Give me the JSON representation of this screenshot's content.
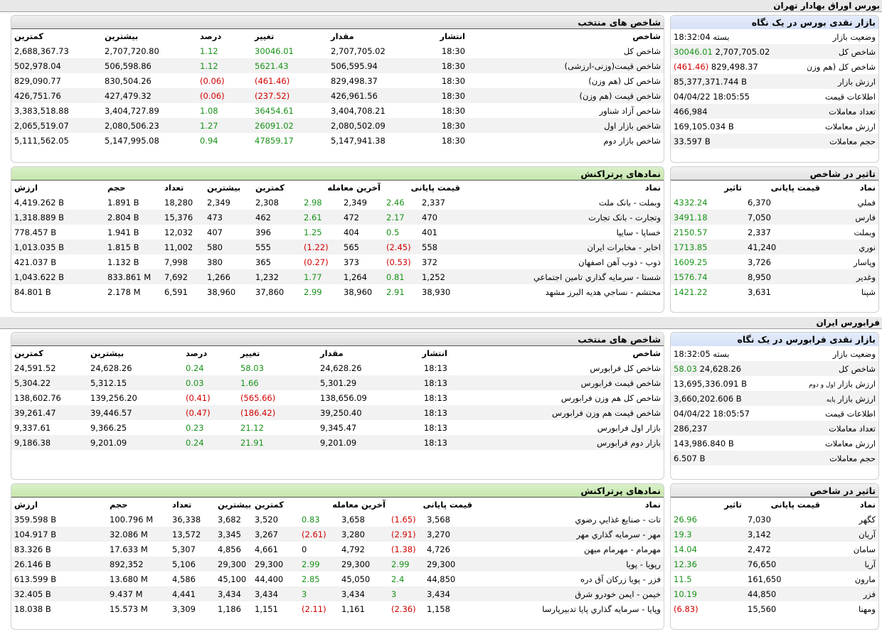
{
  "tse": {
    "title": "بورس اوراق بهادار تهران",
    "snapshot": {
      "title": "بازار نقدی بورس در یک نگاه",
      "rows": [
        {
          "label": "وضعیت بازار",
          "value": "بسته 18:32:04"
        },
        {
          "label": "شاخص کل",
          "value": "2,707,705.02",
          "change": "30046.01",
          "dir": "up"
        },
        {
          "label": "شاخص کل (هم وزن)",
          "value": "829,498.37",
          "change": "(461.46)",
          "dir": "down"
        },
        {
          "label": "ارزش بازار",
          "value": "85,377,371.744 B"
        },
        {
          "label": "اطلاعات قیمت",
          "value": "04/04/22 18:05:55"
        },
        {
          "label": "تعداد معاملات",
          "value": "466,984"
        },
        {
          "label": "ارزش معاملات",
          "value": "169,105.034 B"
        },
        {
          "label": "حجم معاملات",
          "value": "33.597 B"
        }
      ]
    },
    "indices": {
      "title": "شاخص های منتخب",
      "headers": {
        "name": "شاخص",
        "time": "انتشار",
        "value": "مقدار",
        "change": "تغییر",
        "percent": "درصد",
        "high": "بیشترین",
        "low": "کمترین"
      },
      "rows": [
        {
          "name": "شاخص کل",
          "time": "18:30",
          "value": "2,707,705.02",
          "change": "30046.01",
          "percent": "1.12",
          "high": "2,707,720.80",
          "low": "2,688,367.73",
          "dir": "up"
        },
        {
          "name": "شاخص قیمت(وزنی-ارزشی)",
          "time": "18:30",
          "value": "506,595.94",
          "change": "5621.43",
          "percent": "1.12",
          "high": "506,598.86",
          "low": "502,978.04",
          "dir": "up"
        },
        {
          "name": "شاخص کل (هم وزن)",
          "time": "18:30",
          "value": "829,498.37",
          "change": "(461.46)",
          "percent": "(0.06)",
          "high": "830,504.26",
          "low": "829,090.77",
          "dir": "down"
        },
        {
          "name": "شاخص قیمت (هم وزن)",
          "time": "18:30",
          "value": "426,961.56",
          "change": "(237.52)",
          "percent": "(0.06)",
          "high": "427,479.32",
          "low": "426,751.76",
          "dir": "down"
        },
        {
          "name": "شاخص آزاد شناور",
          "time": "18:30",
          "value": "3,404,708.21",
          "change": "36454.61",
          "percent": "1.08",
          "high": "3,404,727.89",
          "low": "3,383,518.88",
          "dir": "up"
        },
        {
          "name": "شاخص بازار اول",
          "time": "18:30",
          "value": "2,080,502.09",
          "change": "26091.02",
          "percent": "1.27",
          "high": "2,080,506.23",
          "low": "2,065,519.07",
          "dir": "up"
        },
        {
          "name": "شاخص بازار دوم",
          "time": "18:30",
          "value": "5,147,941.38",
          "change": "47859.17",
          "percent": "0.94",
          "high": "5,147,995.08",
          "low": "5,111,562.05",
          "dir": "up"
        }
      ]
    },
    "impact": {
      "title": "تاثیر در شاخص",
      "headers": {
        "symbol": "نماد",
        "close": "قیمت پایانی",
        "impact": "تاثیر"
      },
      "rows": [
        {
          "symbol": "فملي",
          "close": "6,370",
          "impact": "4332.24",
          "dir": "up"
        },
        {
          "symbol": "فارس",
          "close": "7,050",
          "impact": "3491.18",
          "dir": "up"
        },
        {
          "symbol": "وبملت",
          "close": "2,337",
          "impact": "2150.57",
          "dir": "up"
        },
        {
          "symbol": "نوري",
          "close": "41,240",
          "impact": "1713.85",
          "dir": "up"
        },
        {
          "symbol": "وپاسار",
          "close": "3,726",
          "impact": "1609.25",
          "dir": "up"
        },
        {
          "symbol": "وغدير",
          "close": "8,950",
          "impact": "1576.74",
          "dir": "up"
        },
        {
          "symbol": "شپنا",
          "close": "3,631",
          "impact": "1421.22",
          "dir": "up"
        }
      ]
    },
    "active": {
      "title": "نمادهای پرتراکنش",
      "headers": {
        "symbol": "نماد",
        "close": "قیمت پایانی",
        "last": "آخرین معامله",
        "low": "کمترین",
        "high": "بیشترین",
        "count": "تعداد",
        "volume": "حجم",
        "value": "ارزش"
      },
      "rows": [
        {
          "symbol": "وبملت - بانک ملت",
          "close": "2,337",
          "close_chg": "2.46",
          "close_dir": "up",
          "last": "2,349",
          "last_chg": "2.98",
          "last_dir": "up",
          "low": "2,308",
          "high": "2,349",
          "count": "18,280",
          "volume": "1.891 B",
          "value": "4,419.262 B"
        },
        {
          "symbol": "وتجارت - بانک تجارت",
          "close": "470",
          "close_chg": "2.17",
          "close_dir": "up",
          "last": "472",
          "last_chg": "2.61",
          "last_dir": "up",
          "low": "462",
          "high": "473",
          "count": "15,376",
          "volume": "2.804 B",
          "value": "1,318.889 B"
        },
        {
          "symbol": "خساپا - سايپا",
          "close": "401",
          "close_chg": "0.5",
          "close_dir": "up",
          "last": "404",
          "last_chg": "1.25",
          "last_dir": "up",
          "low": "396",
          "high": "407",
          "count": "12,032",
          "volume": "1.941 B",
          "value": "778.457 B"
        },
        {
          "symbol": "اخابر - مخابرات ايران",
          "close": "558",
          "close_chg": "(2.45)",
          "close_dir": "down",
          "last": "565",
          "last_chg": "(1.22)",
          "last_dir": "down",
          "low": "555",
          "high": "580",
          "count": "11,002",
          "volume": "1.815 B",
          "value": "1,013.035 B"
        },
        {
          "symbol": "ذوب - ذوب آهن اصفهان",
          "close": "372",
          "close_chg": "(0.53)",
          "close_dir": "down",
          "last": "373",
          "last_chg": "(0.27)",
          "last_dir": "down",
          "low": "365",
          "high": "380",
          "count": "7,998",
          "volume": "1.132 B",
          "value": "421.037 B"
        },
        {
          "symbol": "شستا - سرمايه گذاري تامين اجتماعي",
          "close": "1,252",
          "close_chg": "0.81",
          "close_dir": "up",
          "last": "1,264",
          "last_chg": "1.77",
          "last_dir": "up",
          "low": "1,232",
          "high": "1,266",
          "count": "7,692",
          "volume": "833.861 M",
          "value": "1,043.622 B"
        },
        {
          "symbol": "محتشم - نساجي هديه البرز مشهد",
          "close": "38,930",
          "close_chg": "2.91",
          "close_dir": "up",
          "last": "38,960",
          "last_chg": "2.99",
          "last_dir": "up",
          "low": "37,860",
          "high": "38,960",
          "count": "6,591",
          "volume": "2.178 M",
          "value": "84.801 B"
        }
      ]
    }
  },
  "ifb": {
    "title": "فرابورس ایران",
    "snapshot": {
      "title": "بازار نقدی فرابورس در یک نگاه",
      "rows": [
        {
          "label": "وضعیت بازار",
          "value": "بسته 18:32:05"
        },
        {
          "label": "شاخص کل",
          "value": "24,628.26",
          "change": "58.03",
          "dir": "up"
        },
        {
          "label": "ارزش بازار",
          "label_small": "اول و دوم",
          "value": "13,695,336.091 B"
        },
        {
          "label": "ارزش بازار",
          "label_small": "پایه",
          "value": "3,660,202.606 B"
        },
        {
          "label": "اطلاعات قیمت",
          "value": "04/04/22 18:05:57"
        },
        {
          "label": "تعداد معاملات",
          "value": "286,237"
        },
        {
          "label": "ارزش معاملات",
          "value": "143,986.840 B"
        },
        {
          "label": "حجم معاملات",
          "value": "6.507 B"
        }
      ]
    },
    "indices": {
      "title": "شاخص های منتخب",
      "headers": {
        "name": "شاخص",
        "time": "انتشار",
        "value": "مقدار",
        "change": "تغییر",
        "percent": "درصد",
        "high": "بیشترین",
        "low": "کمترین"
      },
      "rows": [
        {
          "name": "شاخص کل فرابورس",
          "time": "18:13",
          "value": "24,628.26",
          "change": "58.03",
          "percent": "0.24",
          "high": "24,628.26",
          "low": "24,591.52",
          "dir": "up"
        },
        {
          "name": "شاخص قیمت فرابورس",
          "time": "18:13",
          "value": "5,301.29",
          "change": "1.66",
          "percent": "0.03",
          "high": "5,312.15",
          "low": "5,304.22",
          "dir": "up"
        },
        {
          "name": "شاخص کل هم وزن فرابورس",
          "time": "18:13",
          "value": "138,656.09",
          "change": "(565.66)",
          "percent": "(0.41)",
          "high": "139,256.20",
          "low": "138,602.76",
          "dir": "down"
        },
        {
          "name": "شاخص قیمت هم وزن فرابورس",
          "time": "18:13",
          "value": "39,250.40",
          "change": "(186.42)",
          "percent": "(0.47)",
          "high": "39,446.57",
          "low": "39,261.47",
          "dir": "down"
        },
        {
          "name": "بازار اول فرابورس",
          "time": "18:13",
          "value": "9,345.47",
          "change": "21.12",
          "percent": "0.23",
          "high": "9,366.25",
          "low": "9,337.61",
          "dir": "up"
        },
        {
          "name": "بازار دوم فرابورس",
          "time": "18:13",
          "value": "9,201.09",
          "change": "21.91",
          "percent": "0.24",
          "high": "9,201.09",
          "low": "9,186.38",
          "dir": "up"
        }
      ]
    },
    "impact": {
      "title": "تاثیر در شاخص",
      "headers": {
        "symbol": "نماد",
        "close": "قیمت پایانی",
        "impact": "تاثیر"
      },
      "rows": [
        {
          "symbol": "كگهر",
          "close": "7,030",
          "impact": "26.96",
          "dir": "up"
        },
        {
          "symbol": "آريان",
          "close": "3,142",
          "impact": "19.3",
          "dir": "up"
        },
        {
          "symbol": "سامان",
          "close": "2,472",
          "impact": "14.04",
          "dir": "up"
        },
        {
          "symbol": "آريا",
          "close": "76,650",
          "impact": "12.36",
          "dir": "up"
        },
        {
          "symbol": "مارون",
          "close": "161,650",
          "impact": "11.5",
          "dir": "up"
        },
        {
          "symbol": "فزر",
          "close": "44,850",
          "impact": "10.19",
          "dir": "up"
        },
        {
          "symbol": "ومهنا",
          "close": "15,560",
          "impact": "(6.83)",
          "dir": "down"
        }
      ]
    },
    "active": {
      "title": "نمادهای پرتراکنش",
      "headers": {
        "symbol": "نماد",
        "close": "قیمت پایانی",
        "last": "آخرین معامله",
        "low": "کمترین",
        "high": "بیشترین",
        "count": "تعداد",
        "volume": "حجم",
        "value": "ارزش"
      },
      "rows": [
        {
          "symbol": "تات - صنايع غذايي رضوي",
          "close": "3,568",
          "close_chg": "(1.65)",
          "close_dir": "down",
          "last": "3,658",
          "last_chg": "0.83",
          "last_dir": "up",
          "low": "3,520",
          "high": "3,682",
          "count": "36,338",
          "volume": "100.796 M",
          "value": "359.598 B"
        },
        {
          "symbol": "مهر - سرمايه گذاري مهر",
          "close": "3,270",
          "close_chg": "(2.91)",
          "close_dir": "down",
          "last": "3,280",
          "last_chg": "(2.61)",
          "last_dir": "down",
          "low": "3,267",
          "high": "3,345",
          "count": "13,572",
          "volume": "32.086 M",
          "value": "104.917 B"
        },
        {
          "symbol": "مهرمام - مهرمام ميهن",
          "close": "4,726",
          "close_chg": "(1.38)",
          "close_dir": "down",
          "last": "4,792",
          "last_chg": "0",
          "last_dir": "flat",
          "low": "4,661",
          "high": "4,856",
          "count": "5,307",
          "volume": "17.633 M",
          "value": "83.326 B"
        },
        {
          "symbol": "رپويا - پويا",
          "close": "29,300",
          "close_chg": "2.99",
          "close_dir": "up",
          "last": "29,300",
          "last_chg": "2.99",
          "last_dir": "up",
          "low": "29,300",
          "high": "29,300",
          "count": "5,106",
          "volume": "892,352",
          "value": "26.146 B"
        },
        {
          "symbol": "فزر - پويا زركان آق دره",
          "close": "44,850",
          "close_chg": "2.4",
          "close_dir": "up",
          "last": "45,050",
          "last_chg": "2.85",
          "last_dir": "up",
          "low": "44,400",
          "high": "45,100",
          "count": "4,586",
          "volume": "13.680 M",
          "value": "613.599 B"
        },
        {
          "symbol": "خيمن - ايمن خودرو شرق",
          "close": "3,434",
          "close_chg": "3",
          "close_dir": "up",
          "last": "3,434",
          "last_chg": "3",
          "last_dir": "up",
          "low": "3,434",
          "high": "3,434",
          "count": "4,441",
          "volume": "9.437 M",
          "value": "32.405 B"
        },
        {
          "symbol": "وپايا - سرمايه گذاري پايا تدبيرپارسا",
          "close": "1,158",
          "close_chg": "(2.36)",
          "close_dir": "down",
          "last": "1,161",
          "last_chg": "(2.11)",
          "last_dir": "down",
          "low": "1,151",
          "high": "1,186",
          "count": "3,309",
          "volume": "15.573 M",
          "value": "18.038 B"
        }
      ]
    }
  },
  "colors": {
    "up": "#199219",
    "down": "#d10000",
    "header_blue": "#d6e1f7",
    "header_green": "#c6e6ad"
  }
}
